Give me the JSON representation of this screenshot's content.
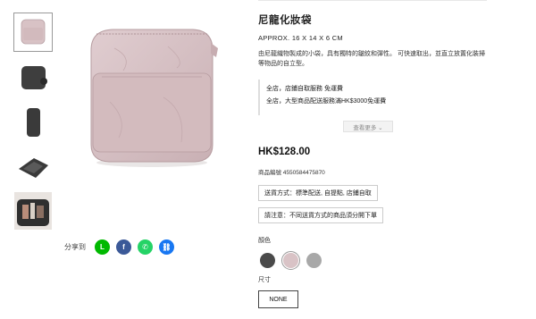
{
  "product": {
    "title": "尼龍化妝袋",
    "size": "APPROX. 16 X 14 X 6 CM",
    "description": "由尼龍織物製成的小袋，具有獨特的皺紋和彈性。 可快速取出，並直立放置化裝掃等物品的自立型。",
    "shipping_lines": [
      "全店，店鋪自取服務 免運費",
      "全店，大型商品配送服務滿HK$3000免運費"
    ],
    "more_label": "查看更多 ⌄",
    "price": "HK$128.00",
    "code": "商品編號 4550584475870",
    "delivery": "送貨方式：標準配送, 自提點, 店鋪自取",
    "notice": "請注意：不同送貨方式的商品須分開下單",
    "color_label": "顏色",
    "colors": [
      {
        "name": "dark-gray",
        "hex": "#4a4a4a"
      },
      {
        "name": "pink",
        "hex": "#d9c3c6",
        "selected": true
      },
      {
        "name": "light-gray",
        "hex": "#a8a8a8"
      }
    ],
    "size_label": "尺寸",
    "size_option": "NONE"
  },
  "share": {
    "label": "分享到",
    "buttons": [
      {
        "name": "line",
        "glyph": "L",
        "color": "#00b900"
      },
      {
        "name": "facebook",
        "glyph": "f",
        "color": "#3b5998"
      },
      {
        "name": "whatsapp",
        "glyph": "✆",
        "color": "#25d366"
      },
      {
        "name": "link",
        "glyph": "⛓",
        "color": "#1877f2"
      }
    ]
  }
}
